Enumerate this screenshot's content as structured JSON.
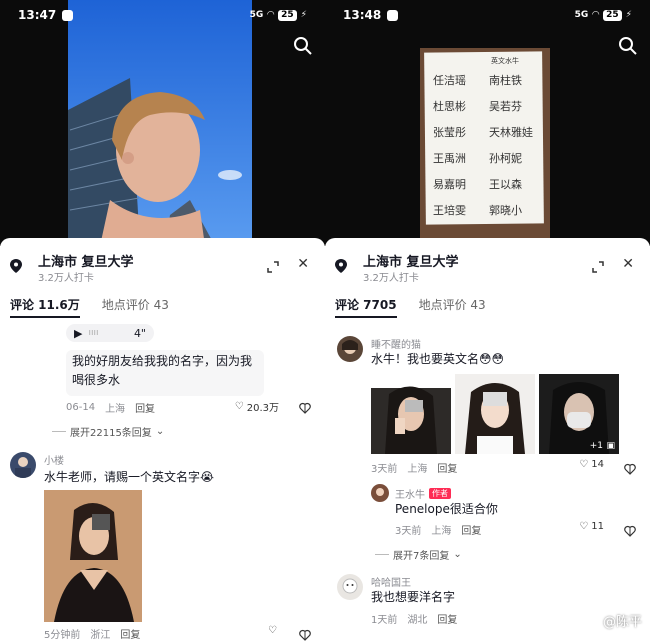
{
  "left": {
    "status": {
      "time": "13:47",
      "signal": "5G",
      "battery": "25"
    },
    "location": {
      "title": "上海市  复旦大学",
      "subtitle": "3.2万人打卡"
    },
    "tabs": [
      "评论 11.6万",
      "地点评价 43"
    ],
    "voice": {
      "duration": "4\""
    },
    "comment1": {
      "text": "我的好朋友给我我的名字，因为我喝很多水",
      "date": "06-14",
      "place": "上海",
      "reply_label": "回复",
      "likes": "20.3万",
      "expand": "展开22115条回复"
    },
    "comment2": {
      "user": "小楼",
      "text": "水牛老师，请赐一个英文名字😭",
      "date": "5分钟前",
      "place": "浙江",
      "reply_label": "回复"
    }
  },
  "right": {
    "status": {
      "time": "13:48",
      "signal": "5G",
      "battery": "25"
    },
    "location": {
      "title": "上海市  复旦大学",
      "subtitle": "3.2万人打卡"
    },
    "tabs": [
      "评论 7705",
      "地点评价 43"
    ],
    "note": {
      "heading": "英文水牛",
      "rows": [
        [
          "任洁瑶",
          "南柱铁"
        ],
        [
          "杜思彬",
          "吴若芬"
        ],
        [
          "张莹彤",
          "天林雅娃"
        ],
        [
          "王禹洲",
          "孙柯妮"
        ],
        [
          "易嘉明",
          "王以森"
        ],
        [
          "王培雯",
          "郭晓小"
        ]
      ]
    },
    "comment1": {
      "user": "睡不醒的猫",
      "text": "水牛！我也要英文名😳😳",
      "more_count": "+1",
      "date": "3天前",
      "place": "上海",
      "reply_label": "回复",
      "likes": "14"
    },
    "reply1": {
      "user": "王水牛",
      "badge": "作者",
      "text": "Penelope很适合你",
      "date": "3天前",
      "place": "上海",
      "reply_label": "回复",
      "likes": "11",
      "expand": "展开7条回复"
    },
    "comment2": {
      "user": "哈哈国王",
      "text": "我也想要洋名字",
      "date": "1天前",
      "place": "湖北",
      "reply_label": "回复"
    },
    "watermark": "@陈平"
  },
  "colors": {
    "accent": "#fe2c55",
    "text": "#161823",
    "muted": "#8a8b91",
    "sky": "#2b6fd8"
  },
  "icons": [
    "search-icon",
    "location-pin-icon",
    "expand-icon",
    "close-icon",
    "play-icon",
    "heart-icon",
    "dislike-icon",
    "chevron-down-icon",
    "gallery-icon"
  ]
}
